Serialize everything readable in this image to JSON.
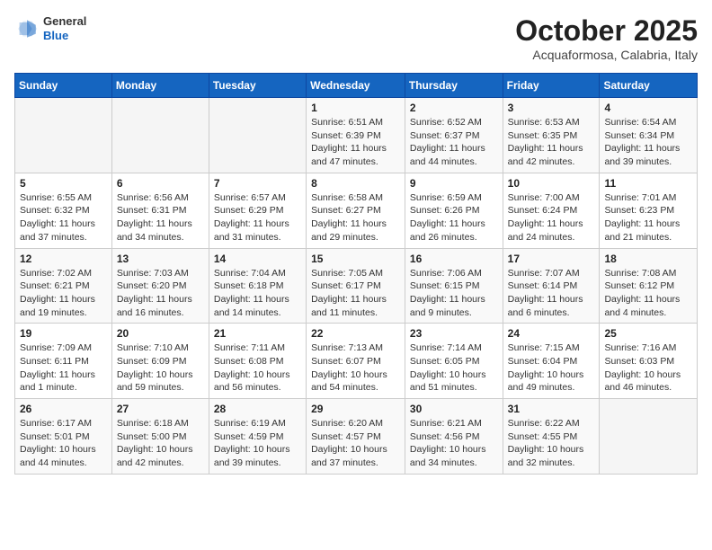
{
  "logo": {
    "general": "General",
    "blue": "Blue"
  },
  "header": {
    "month_title": "October 2025",
    "location": "Acquaformosa, Calabria, Italy"
  },
  "weekdays": [
    "Sunday",
    "Monday",
    "Tuesday",
    "Wednesday",
    "Thursday",
    "Friday",
    "Saturday"
  ],
  "weeks": [
    [
      {
        "day": "",
        "info": ""
      },
      {
        "day": "",
        "info": ""
      },
      {
        "day": "",
        "info": ""
      },
      {
        "day": "1",
        "info": "Sunrise: 6:51 AM\nSunset: 6:39 PM\nDaylight: 11 hours and 47 minutes."
      },
      {
        "day": "2",
        "info": "Sunrise: 6:52 AM\nSunset: 6:37 PM\nDaylight: 11 hours and 44 minutes."
      },
      {
        "day": "3",
        "info": "Sunrise: 6:53 AM\nSunset: 6:35 PM\nDaylight: 11 hours and 42 minutes."
      },
      {
        "day": "4",
        "info": "Sunrise: 6:54 AM\nSunset: 6:34 PM\nDaylight: 11 hours and 39 minutes."
      }
    ],
    [
      {
        "day": "5",
        "info": "Sunrise: 6:55 AM\nSunset: 6:32 PM\nDaylight: 11 hours and 37 minutes."
      },
      {
        "day": "6",
        "info": "Sunrise: 6:56 AM\nSunset: 6:31 PM\nDaylight: 11 hours and 34 minutes."
      },
      {
        "day": "7",
        "info": "Sunrise: 6:57 AM\nSunset: 6:29 PM\nDaylight: 11 hours and 31 minutes."
      },
      {
        "day": "8",
        "info": "Sunrise: 6:58 AM\nSunset: 6:27 PM\nDaylight: 11 hours and 29 minutes."
      },
      {
        "day": "9",
        "info": "Sunrise: 6:59 AM\nSunset: 6:26 PM\nDaylight: 11 hours and 26 minutes."
      },
      {
        "day": "10",
        "info": "Sunrise: 7:00 AM\nSunset: 6:24 PM\nDaylight: 11 hours and 24 minutes."
      },
      {
        "day": "11",
        "info": "Sunrise: 7:01 AM\nSunset: 6:23 PM\nDaylight: 11 hours and 21 minutes."
      }
    ],
    [
      {
        "day": "12",
        "info": "Sunrise: 7:02 AM\nSunset: 6:21 PM\nDaylight: 11 hours and 19 minutes."
      },
      {
        "day": "13",
        "info": "Sunrise: 7:03 AM\nSunset: 6:20 PM\nDaylight: 11 hours and 16 minutes."
      },
      {
        "day": "14",
        "info": "Sunrise: 7:04 AM\nSunset: 6:18 PM\nDaylight: 11 hours and 14 minutes."
      },
      {
        "day": "15",
        "info": "Sunrise: 7:05 AM\nSunset: 6:17 PM\nDaylight: 11 hours and 11 minutes."
      },
      {
        "day": "16",
        "info": "Sunrise: 7:06 AM\nSunset: 6:15 PM\nDaylight: 11 hours and 9 minutes."
      },
      {
        "day": "17",
        "info": "Sunrise: 7:07 AM\nSunset: 6:14 PM\nDaylight: 11 hours and 6 minutes."
      },
      {
        "day": "18",
        "info": "Sunrise: 7:08 AM\nSunset: 6:12 PM\nDaylight: 11 hours and 4 minutes."
      }
    ],
    [
      {
        "day": "19",
        "info": "Sunrise: 7:09 AM\nSunset: 6:11 PM\nDaylight: 11 hours and 1 minute."
      },
      {
        "day": "20",
        "info": "Sunrise: 7:10 AM\nSunset: 6:09 PM\nDaylight: 10 hours and 59 minutes."
      },
      {
        "day": "21",
        "info": "Sunrise: 7:11 AM\nSunset: 6:08 PM\nDaylight: 10 hours and 56 minutes."
      },
      {
        "day": "22",
        "info": "Sunrise: 7:13 AM\nSunset: 6:07 PM\nDaylight: 10 hours and 54 minutes."
      },
      {
        "day": "23",
        "info": "Sunrise: 7:14 AM\nSunset: 6:05 PM\nDaylight: 10 hours and 51 minutes."
      },
      {
        "day": "24",
        "info": "Sunrise: 7:15 AM\nSunset: 6:04 PM\nDaylight: 10 hours and 49 minutes."
      },
      {
        "day": "25",
        "info": "Sunrise: 7:16 AM\nSunset: 6:03 PM\nDaylight: 10 hours and 46 minutes."
      }
    ],
    [
      {
        "day": "26",
        "info": "Sunrise: 6:17 AM\nSunset: 5:01 PM\nDaylight: 10 hours and 44 minutes."
      },
      {
        "day": "27",
        "info": "Sunrise: 6:18 AM\nSunset: 5:00 PM\nDaylight: 10 hours and 42 minutes."
      },
      {
        "day": "28",
        "info": "Sunrise: 6:19 AM\nSunset: 4:59 PM\nDaylight: 10 hours and 39 minutes."
      },
      {
        "day": "29",
        "info": "Sunrise: 6:20 AM\nSunset: 4:57 PM\nDaylight: 10 hours and 37 minutes."
      },
      {
        "day": "30",
        "info": "Sunrise: 6:21 AM\nSunset: 4:56 PM\nDaylight: 10 hours and 34 minutes."
      },
      {
        "day": "31",
        "info": "Sunrise: 6:22 AM\nSunset: 4:55 PM\nDaylight: 10 hours and 32 minutes."
      },
      {
        "day": "",
        "info": ""
      }
    ]
  ]
}
